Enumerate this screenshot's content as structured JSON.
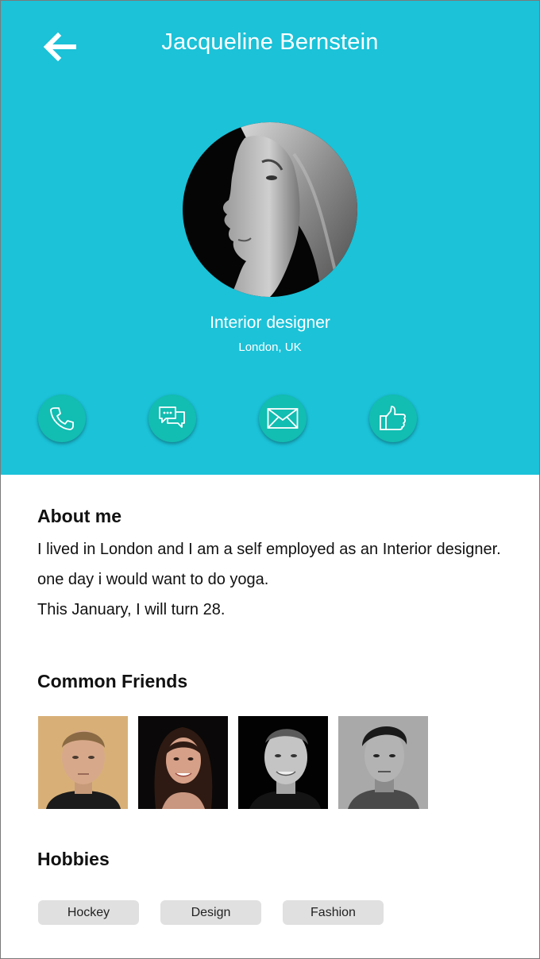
{
  "header": {
    "title": "Jacqueline Bernstein",
    "back_icon": "arrow-left-icon",
    "background_color": "#1bc2d8"
  },
  "profile": {
    "role": "Interior designer",
    "location": "London, UK"
  },
  "actions": [
    {
      "icon": "phone-icon"
    },
    {
      "icon": "chat-icon"
    },
    {
      "icon": "mail-icon"
    },
    {
      "icon": "thumbs-up-icon"
    }
  ],
  "action_color": "#12bdb1",
  "about": {
    "heading": "About me",
    "lines": [
      "I lived in London and I am a self employed as an Interior designer. one day i would want to do yoga.",
      "This January, I will turn 28."
    ]
  },
  "friends": {
    "heading": "Common Friends",
    "count": 4
  },
  "hobbies": {
    "heading": "Hobbies",
    "items": [
      "Hockey",
      "Design",
      "Fashion"
    ]
  }
}
